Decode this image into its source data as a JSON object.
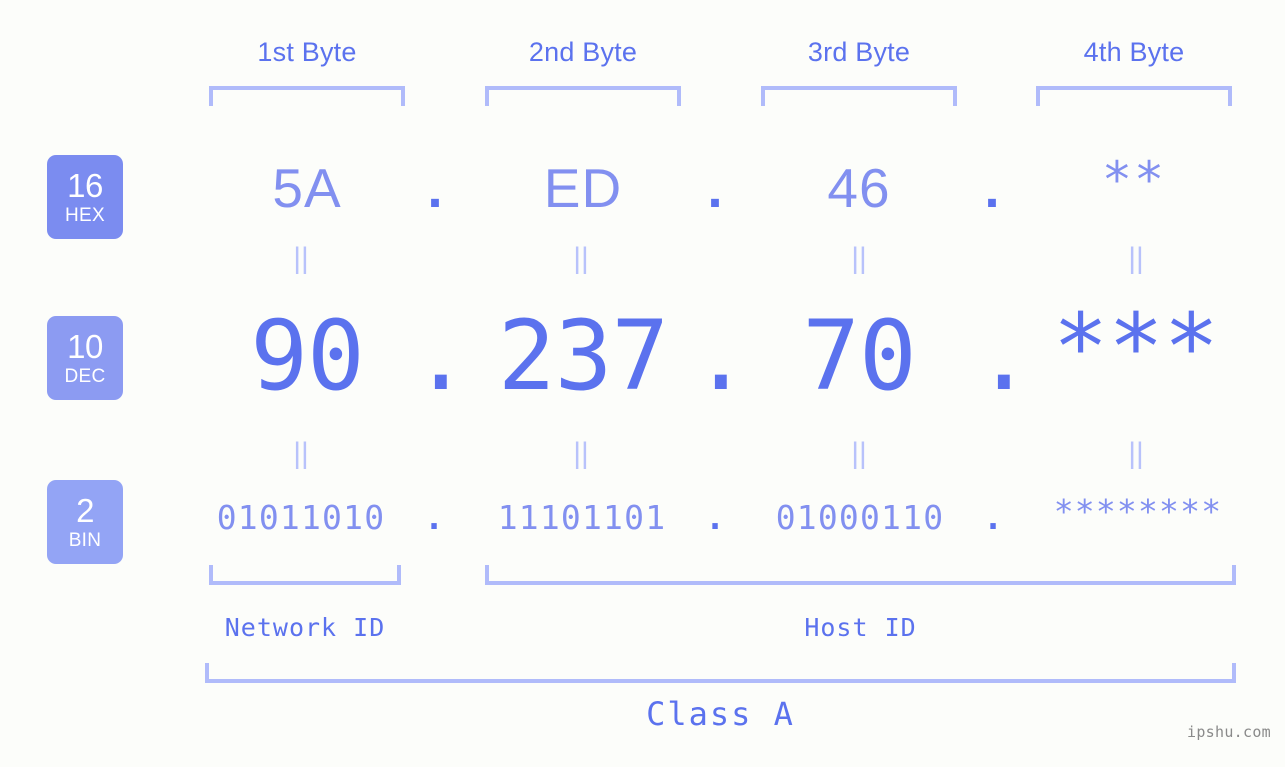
{
  "meta": {
    "watermark": "ipshu.com"
  },
  "byte_headers": [
    {
      "label": "1st Byte"
    },
    {
      "label": "2nd Byte"
    },
    {
      "label": "3rd Byte"
    },
    {
      "label": "4th Byte"
    }
  ],
  "radix_badges": [
    {
      "number": "16",
      "name": "HEX",
      "color": "#7b8cf0"
    },
    {
      "number": "10",
      "name": "DEC",
      "color": "#8c9bf2"
    },
    {
      "number": "2",
      "name": "BIN",
      "color": "#93a4f5"
    }
  ],
  "rows": {
    "hex": {
      "radix": "16",
      "radix_name": "HEX",
      "bytes": [
        "5A",
        "ED",
        "46",
        "**"
      ],
      "separator": "."
    },
    "dec": {
      "radix": "10",
      "radix_name": "DEC",
      "bytes": [
        "90",
        "237",
        "70",
        "***"
      ],
      "separator": "."
    },
    "bin": {
      "radix": "2",
      "radix_name": "BIN",
      "bytes": [
        "01011010",
        "11101101",
        "01000110",
        "********"
      ],
      "separator": "."
    }
  },
  "equals_marks": {
    "glyph": "||",
    "color": "#b8c2fb"
  },
  "segments": {
    "network_id": "Network ID",
    "host_id": "Host ID",
    "class": "Class A"
  },
  "colors": {
    "background": "#fcfdfa",
    "accent_strong": "#5b72ee",
    "accent_mid": "#8290f0",
    "accent_light": "#b0bbfa",
    "badge_hex": "#7b8cf0",
    "badge_dec": "#8c9bf2",
    "badge_bin": "#93a4f5",
    "watermark": "#8a8a8a"
  }
}
